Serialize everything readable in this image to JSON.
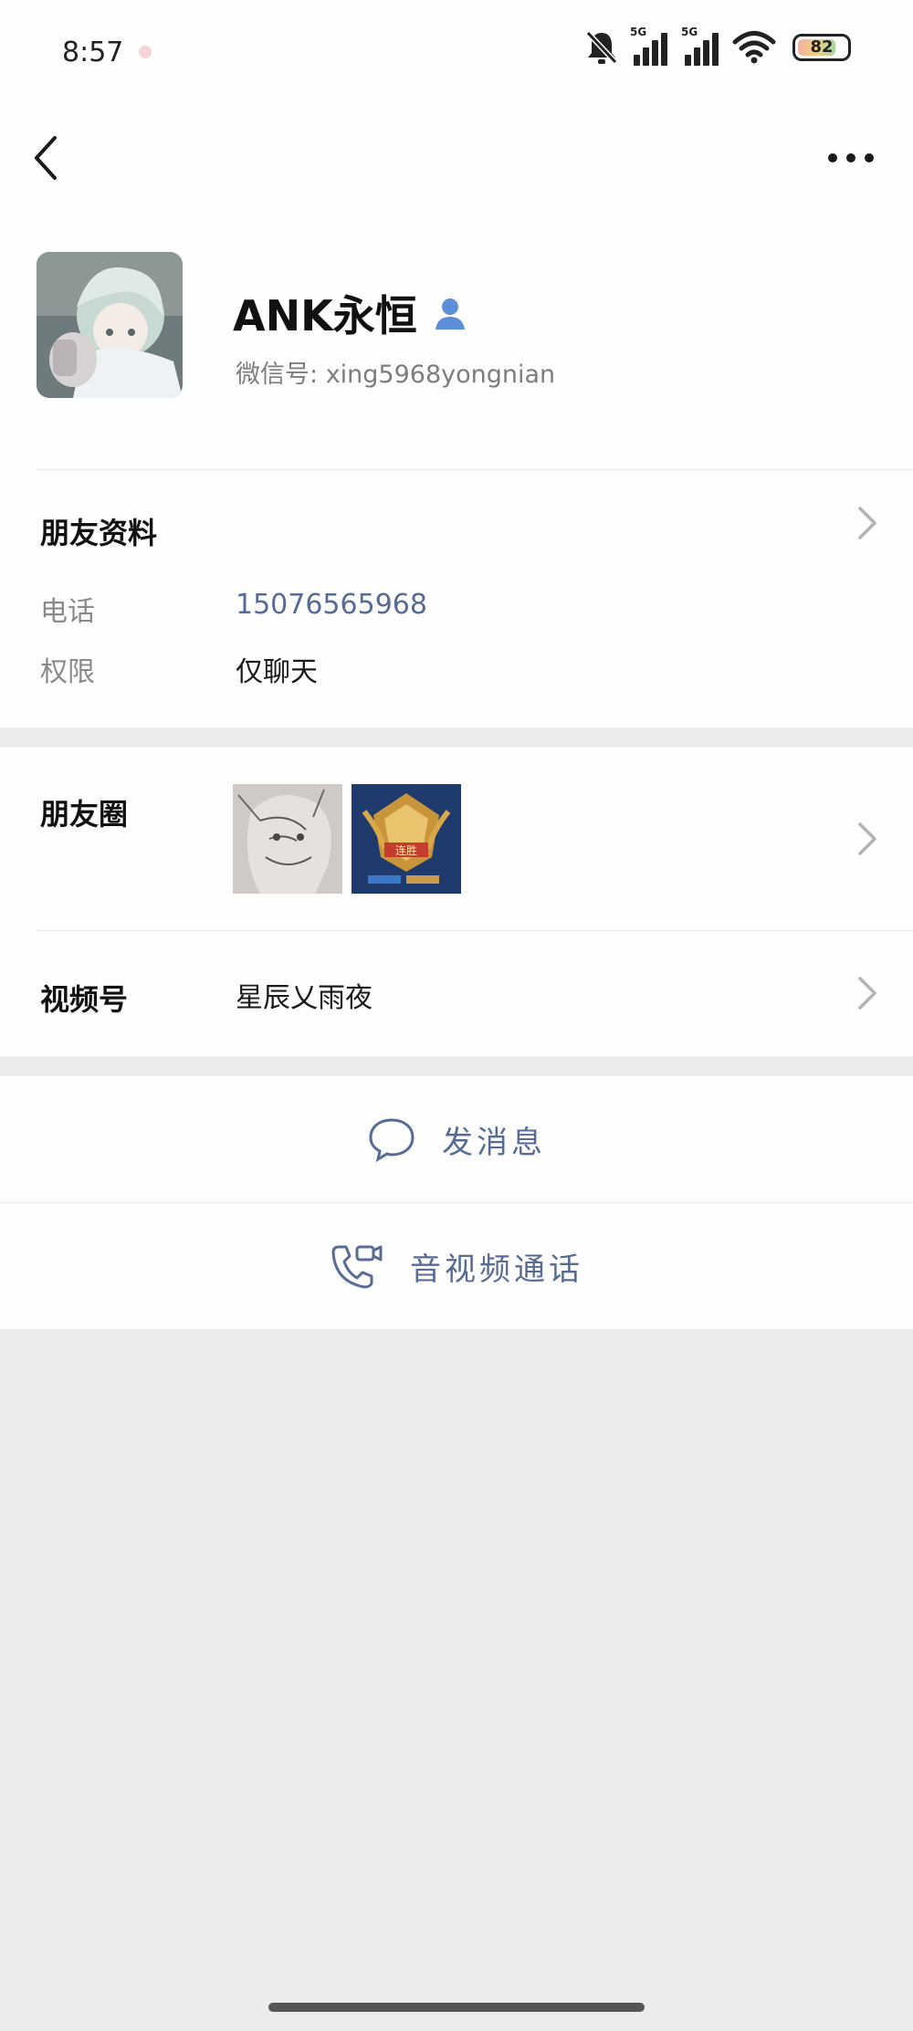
{
  "status_bar": {
    "time": "8:57",
    "network_1": "5G",
    "network_2": "5G",
    "battery_level": "82",
    "icons": [
      "bell-off-icon",
      "signal-icon",
      "signal-icon",
      "wifi-icon",
      "battery-icon"
    ]
  },
  "nav": {
    "back_icon": "chevron-left-icon",
    "more_icon": "more-dots-icon"
  },
  "profile": {
    "nickname": "ANK永恒",
    "badge_icon": "person-icon",
    "wechat_id_label": "微信号:",
    "wechat_id": "xing5968yongnian"
  },
  "friend_info": {
    "title": "朋友资料",
    "phone_label": "电话",
    "phone_value": "15076565968",
    "permission_label": "权限",
    "permission_value": "仅聊天"
  },
  "moments": {
    "label": "朋友圈",
    "thumbnails": [
      "sketch-girl-image",
      "game-rank-badge-image"
    ],
    "thumb2_banner_text": "连胜"
  },
  "channels": {
    "label": "视频号",
    "value": "星辰乂雨夜"
  },
  "actions": {
    "message_label": "发消息",
    "message_icon": "chat-bubble-icon",
    "call_label": "音视频通话",
    "call_icon": "video-call-icon"
  },
  "colors": {
    "link": "#576b95",
    "page_bg": "#ececec",
    "card_bg": "#fefefe"
  }
}
